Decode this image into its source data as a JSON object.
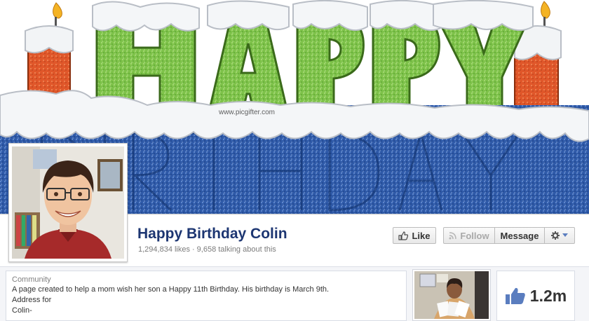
{
  "cover": {
    "watermark": "www.picgifter.com",
    "banner_word_1": "HAPPY",
    "banner_word_2": "BIRTHDAY"
  },
  "page": {
    "name": "Happy Birthday Colin",
    "likes": "1,294,834 likes",
    "separator": "·",
    "talking": "9,658 talking about this"
  },
  "actions": {
    "like_label": "Like",
    "follow_label": "Follow",
    "message_label": "Message"
  },
  "about": {
    "category": "Community",
    "description": "A page created to help a mom wish her son a Happy 11th Birthday. His birthday is March 9th.",
    "line2": "Address for",
    "line3": "Colin-"
  },
  "likes_box": {
    "count": "1.2m"
  },
  "colors": {
    "page_name": "#1d3672",
    "like_blue": "#5a7dbf",
    "cake_green": "#7ec24a",
    "cake_blue": "#2f5aa8",
    "candle_orange": "#e0572a"
  }
}
